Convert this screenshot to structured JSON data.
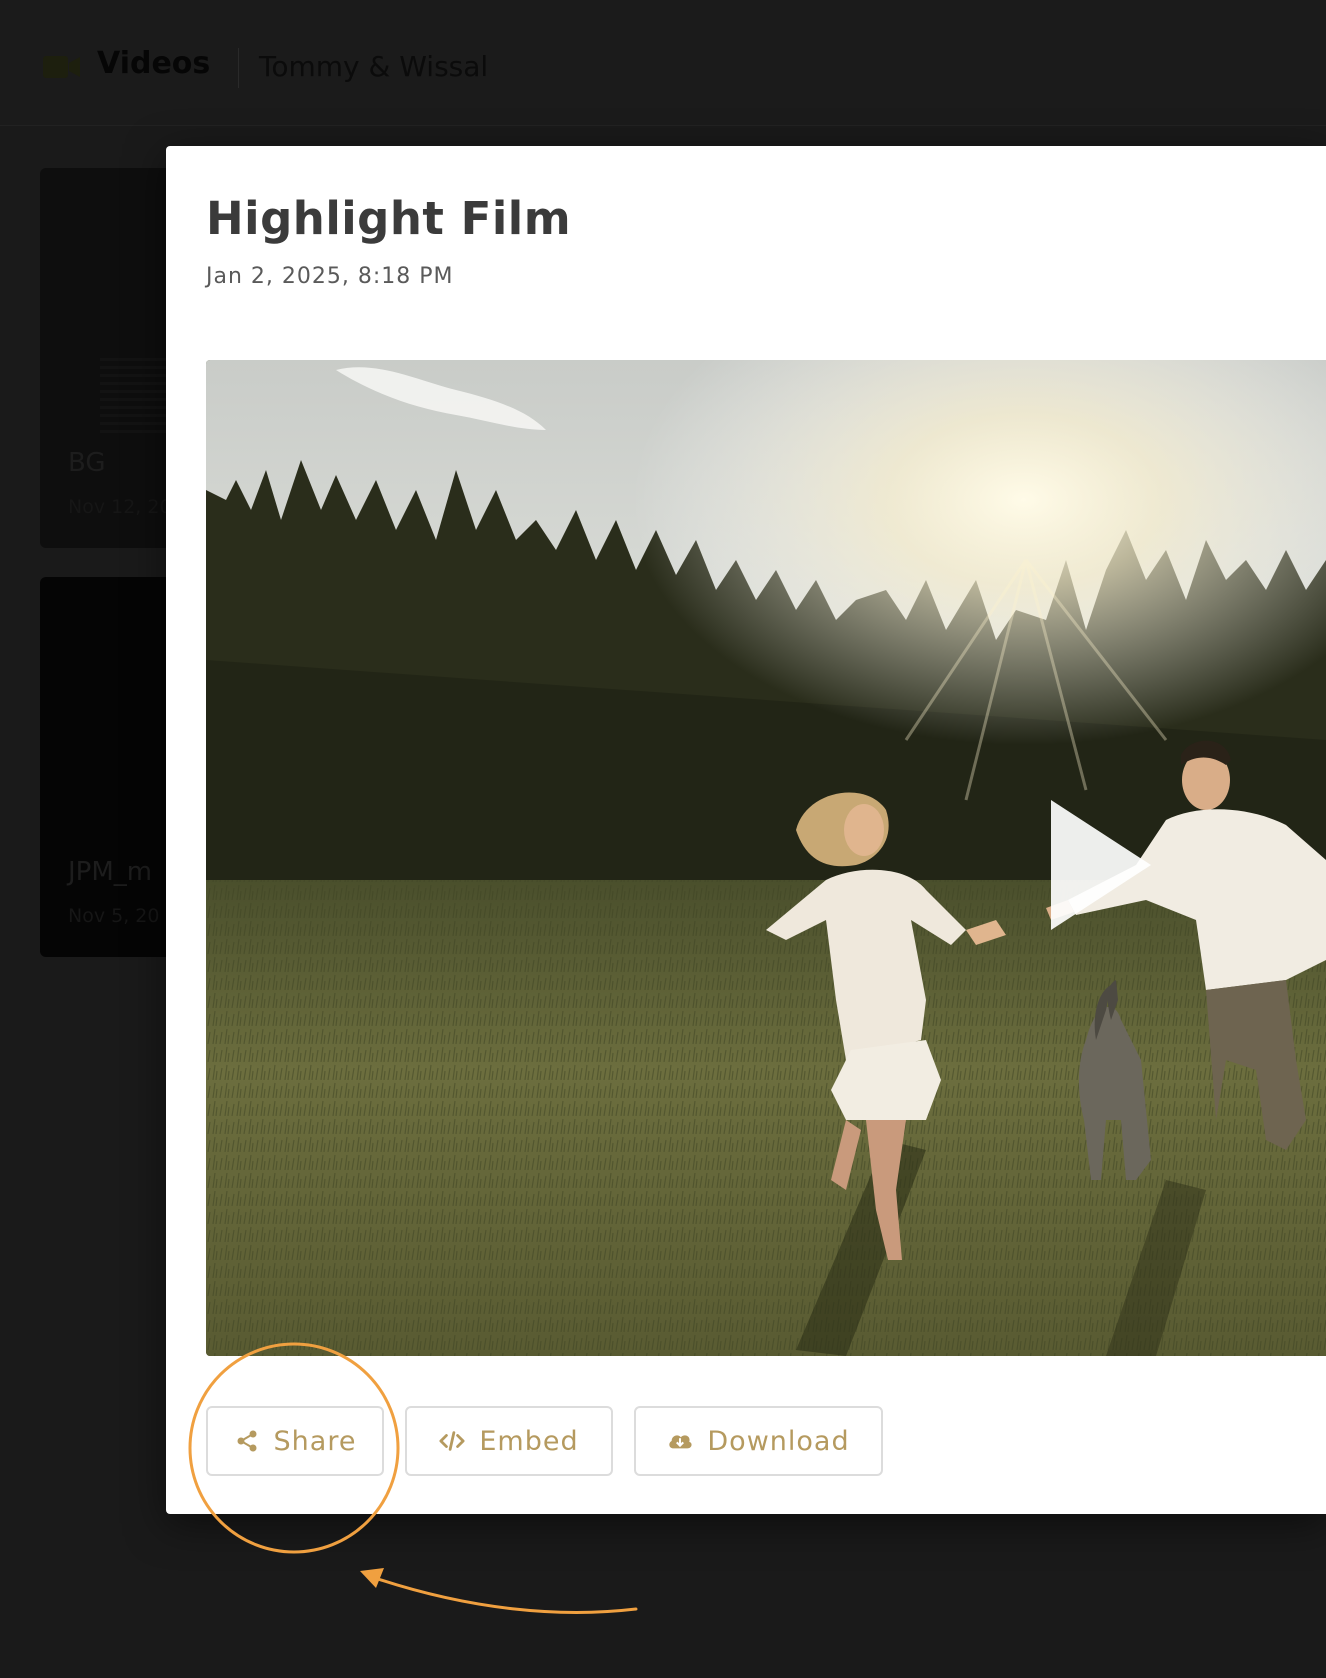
{
  "header": {
    "section_title": "Videos",
    "project_title": "Tommy & Wissal",
    "icon": "video-camera-icon"
  },
  "background_cards": [
    {
      "title": "BG",
      "date": "Nov 12, 20"
    },
    {
      "title": "JPM_m",
      "date": "Nov 5, 20"
    }
  ],
  "modal": {
    "title": "Highlight Film",
    "date": "Jan 2, 2025, 8:18 PM",
    "video": {
      "thumbnail": "couple running in meadow with dog at sunset",
      "play_icon": "play-icon"
    },
    "actions": [
      {
        "label": "Share",
        "icon": "share-icon"
      },
      {
        "label": "Embed",
        "icon": "code-icon"
      },
      {
        "label": "Download",
        "icon": "cloud-download-icon"
      }
    ]
  },
  "colors": {
    "accent": "#b59a5f",
    "annotation": "#f0a040",
    "backdrop": "#1a1a1a",
    "button_border": "#dcdcdc"
  }
}
